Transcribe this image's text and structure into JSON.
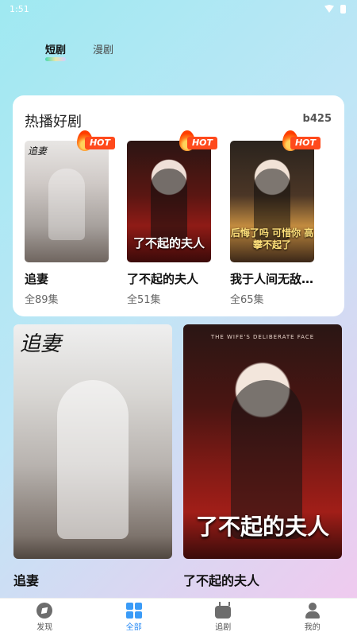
{
  "status_bar": {
    "time": "1:51"
  },
  "top_tabs": [
    {
      "label": "短剧",
      "active": true
    },
    {
      "label": "漫剧",
      "active": false
    }
  ],
  "hot_section": {
    "title": "热播好剧",
    "code": "b425",
    "badge": "HOT",
    "items": [
      {
        "name": "追妻",
        "episodes": "全89集",
        "cover_text": "追妻"
      },
      {
        "name": "了不起的夫人",
        "episodes": "全51集",
        "cover_text": "了不起的夫人"
      },
      {
        "name": "我于人间无敌…",
        "episodes": "全65集",
        "cover_text": "后悔了吗 可惜你 高攀不起了"
      }
    ]
  },
  "feed": [
    {
      "name": "追妻",
      "cover_text": "追妻"
    },
    {
      "name": "了不起的夫人",
      "cover_text": "了不起的夫人",
      "cover_subtitle": "THE WIFE'S DELIBERATE FACE"
    }
  ],
  "bottom_nav": [
    {
      "label": "发现",
      "icon": "compass-icon"
    },
    {
      "label": "全部",
      "icon": "grid-icon",
      "active": true
    },
    {
      "label": "追剧",
      "icon": "tv-icon"
    },
    {
      "label": "我的",
      "icon": "user-icon"
    }
  ],
  "colors": {
    "accent": "#2b8cf5",
    "hot_badge": "#ff4a1c"
  }
}
